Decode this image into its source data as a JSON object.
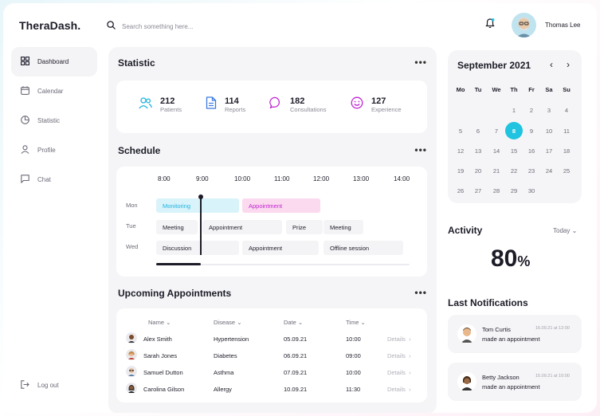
{
  "app": {
    "title": "TheraDash."
  },
  "search": {
    "placeholder": "Search something here..."
  },
  "user": {
    "name": "Thomas Lee"
  },
  "sidebar": {
    "items": [
      {
        "label": "Dashboard",
        "icon": "grid-icon",
        "active": true
      },
      {
        "label": "Calendar",
        "icon": "calendar-icon"
      },
      {
        "label": "Statistic",
        "icon": "pie-chart-icon"
      },
      {
        "label": "Profile",
        "icon": "user-icon"
      },
      {
        "label": "Chat",
        "icon": "chat-icon"
      }
    ],
    "logout": "Log out"
  },
  "statistic": {
    "title": "Statistic",
    "more": "•••",
    "items": [
      {
        "value": "212",
        "label": "Patients",
        "icon": "users-icon",
        "color": "#20b4e0"
      },
      {
        "value": "114",
        "label": "Reports",
        "icon": "document-icon",
        "color": "#3b7be0"
      },
      {
        "value": "182",
        "label": "Consultations",
        "icon": "chat-bubble-icon",
        "color": "#c026d3"
      },
      {
        "value": "127",
        "label": "Experience",
        "icon": "smile-icon",
        "color": "#c026d3"
      }
    ]
  },
  "schedule": {
    "title": "Schedule",
    "more": "•••",
    "times": [
      "8:00",
      "9:00",
      "10:00",
      "11:00",
      "12:00",
      "13:00",
      "14:00"
    ],
    "days": [
      "Mon",
      "Tue",
      "Wed"
    ],
    "mon": {
      "a": "Monitoring",
      "b": "Appointment"
    },
    "tue": {
      "a": "Meeting",
      "b": "Appointment",
      "c": "Prize",
      "d": "Meeting"
    },
    "wed": {
      "a": "Discussion",
      "b": "Appointment",
      "c": "Offline session"
    }
  },
  "appointments": {
    "title": "Upcoming Appointments",
    "more": "•••",
    "columns": [
      "Name",
      "Disease",
      "Date",
      "Time"
    ],
    "details_label": "Details",
    "rows": [
      {
        "name": "Alex Smith",
        "disease": "Hypertension",
        "date": "05.09.21",
        "time": "10:00"
      },
      {
        "name": "Sarah Jones",
        "disease": "Diabetes",
        "date": "06.09.21",
        "time": "09:00"
      },
      {
        "name": "Samuel Dutton",
        "disease": "Asthma",
        "date": "07.09.21",
        "time": "10:00"
      },
      {
        "name": "Carolina Gilson",
        "disease": "Allergy",
        "date": "10.09.21",
        "time": "11:30"
      }
    ]
  },
  "calendar": {
    "month": "September 2021",
    "weekdays": [
      "Mo",
      "Tu",
      "We",
      "Th",
      "Fr",
      "Sa",
      "Su"
    ],
    "selected": "8",
    "accent": "#20c3e0"
  },
  "activity": {
    "title": "Activity",
    "period": "Today",
    "value": "80",
    "unit": "%"
  },
  "notifications": {
    "title": "Last Notifications",
    "items": [
      {
        "name": "Tom Curtis",
        "time": "16.09.21 at 12:00",
        "message": "made an appointment"
      },
      {
        "name": "Betty Jackson",
        "time": "15.09.21 at 10:00",
        "message": "made an appointment"
      }
    ]
  }
}
